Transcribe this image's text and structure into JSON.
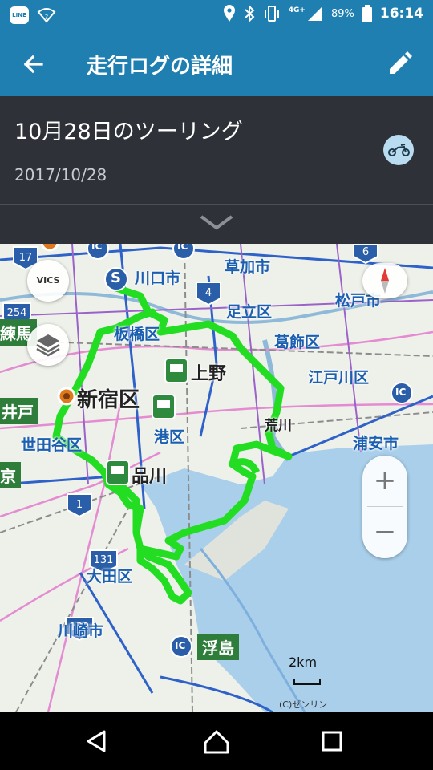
{
  "status_bar": {
    "line_label": "LINE",
    "network_label": "4G+",
    "battery": "89%",
    "time": "16:14"
  },
  "app_bar": {
    "title": "走行ログの詳細",
    "back_icon": "arrow-back-icon",
    "edit_icon": "pencil-icon"
  },
  "trip": {
    "title": "10月28日のツーリング",
    "date": "2017/10/28",
    "icon": "motorcycle-icon"
  },
  "map": {
    "vics_label": "VICS",
    "labels": {
      "kawaguchi": "川口市",
      "soka": "草加市",
      "adachi": "足立区",
      "matsudo": "松戸市",
      "itabashi": "板橋区",
      "katsushika": "葛飾区",
      "ueno": "上野",
      "edogawa": "江戸川区",
      "nerima": "練馬",
      "shinjuku": "新宿区",
      "arakawa": "荒川",
      "urayasu": "浦安市",
      "setagaya": "世田谷区",
      "minato": "港区",
      "shinagawa": "品川",
      "ota": "大田区",
      "kawasaki": "川崎市",
      "ukishima": "浮島",
      "ido": "井戸",
      "kyo": "京"
    },
    "route_numbers": [
      "17",
      "254",
      "4",
      "6",
      "1",
      "131",
      "132"
    ],
    "ic_label": "IC",
    "start_label": "S",
    "scale": "2km",
    "copyright": "(C)ゼンリン",
    "route_color": "#22dd22",
    "zoom_in": "+",
    "zoom_out": "−"
  },
  "nav": {
    "back_icon": "triangle-back-icon",
    "home_icon": "circle-home-icon",
    "recent_icon": "square-recents-icon"
  }
}
